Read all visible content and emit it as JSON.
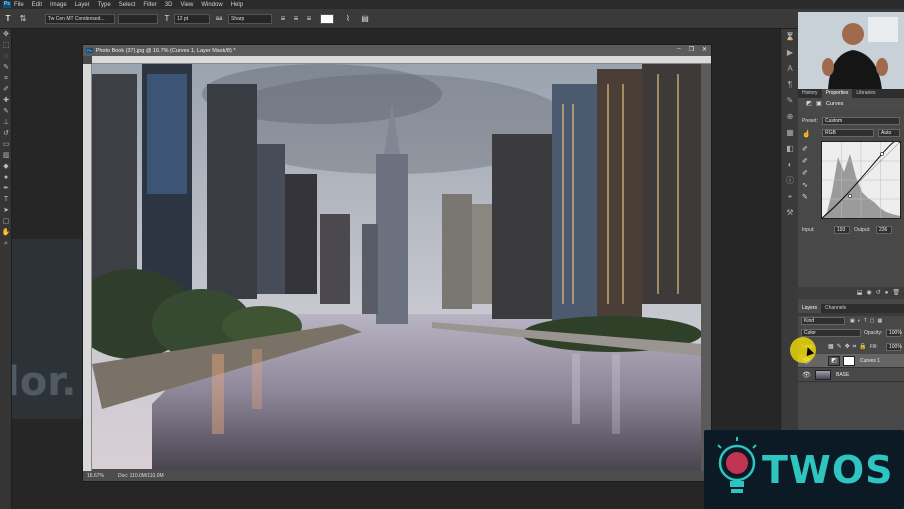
{
  "menubar": {
    "items": [
      "File",
      "Edit",
      "Image",
      "Layer",
      "Type",
      "Select",
      "Filter",
      "3D",
      "View",
      "Window",
      "Help"
    ]
  },
  "options": {
    "font_family": "Tw Cen MT Condensed...",
    "font_size": "12 pt",
    "antialias": "Sharp"
  },
  "document": {
    "title": "Photo Book (37).jpg @ 16.7% (Curves 1, Layer Mask/8) *",
    "zoom": "16.67%",
    "doc_size": "Doc: 110.0M/110.0M"
  },
  "properties": {
    "tabs": [
      "History",
      "Properties",
      "Libraries"
    ],
    "panel_title": "Curves",
    "preset_label": "Preset:",
    "preset_value": "Custom",
    "channel_value": "RGB",
    "auto_label": "Auto",
    "input_label": "Input:",
    "input_value": "193",
    "output_label": "Output:",
    "output_value": "236"
  },
  "layers": {
    "tabs": [
      "Layers",
      "Channels"
    ],
    "filter_kind": "Kind",
    "blend_mode": "Color",
    "opacity_label": "Opacity:",
    "opacity_value": "100%",
    "fill_label": "Fill:",
    "fill_value": "100%",
    "items": [
      {
        "name": "Curves 1"
      },
      {
        "name": "BASE"
      }
    ]
  },
  "background_text": "lor.",
  "watermark": "TWOS",
  "colors": {
    "accent": "#2ec4c0",
    "highlight": "#ffe800"
  }
}
